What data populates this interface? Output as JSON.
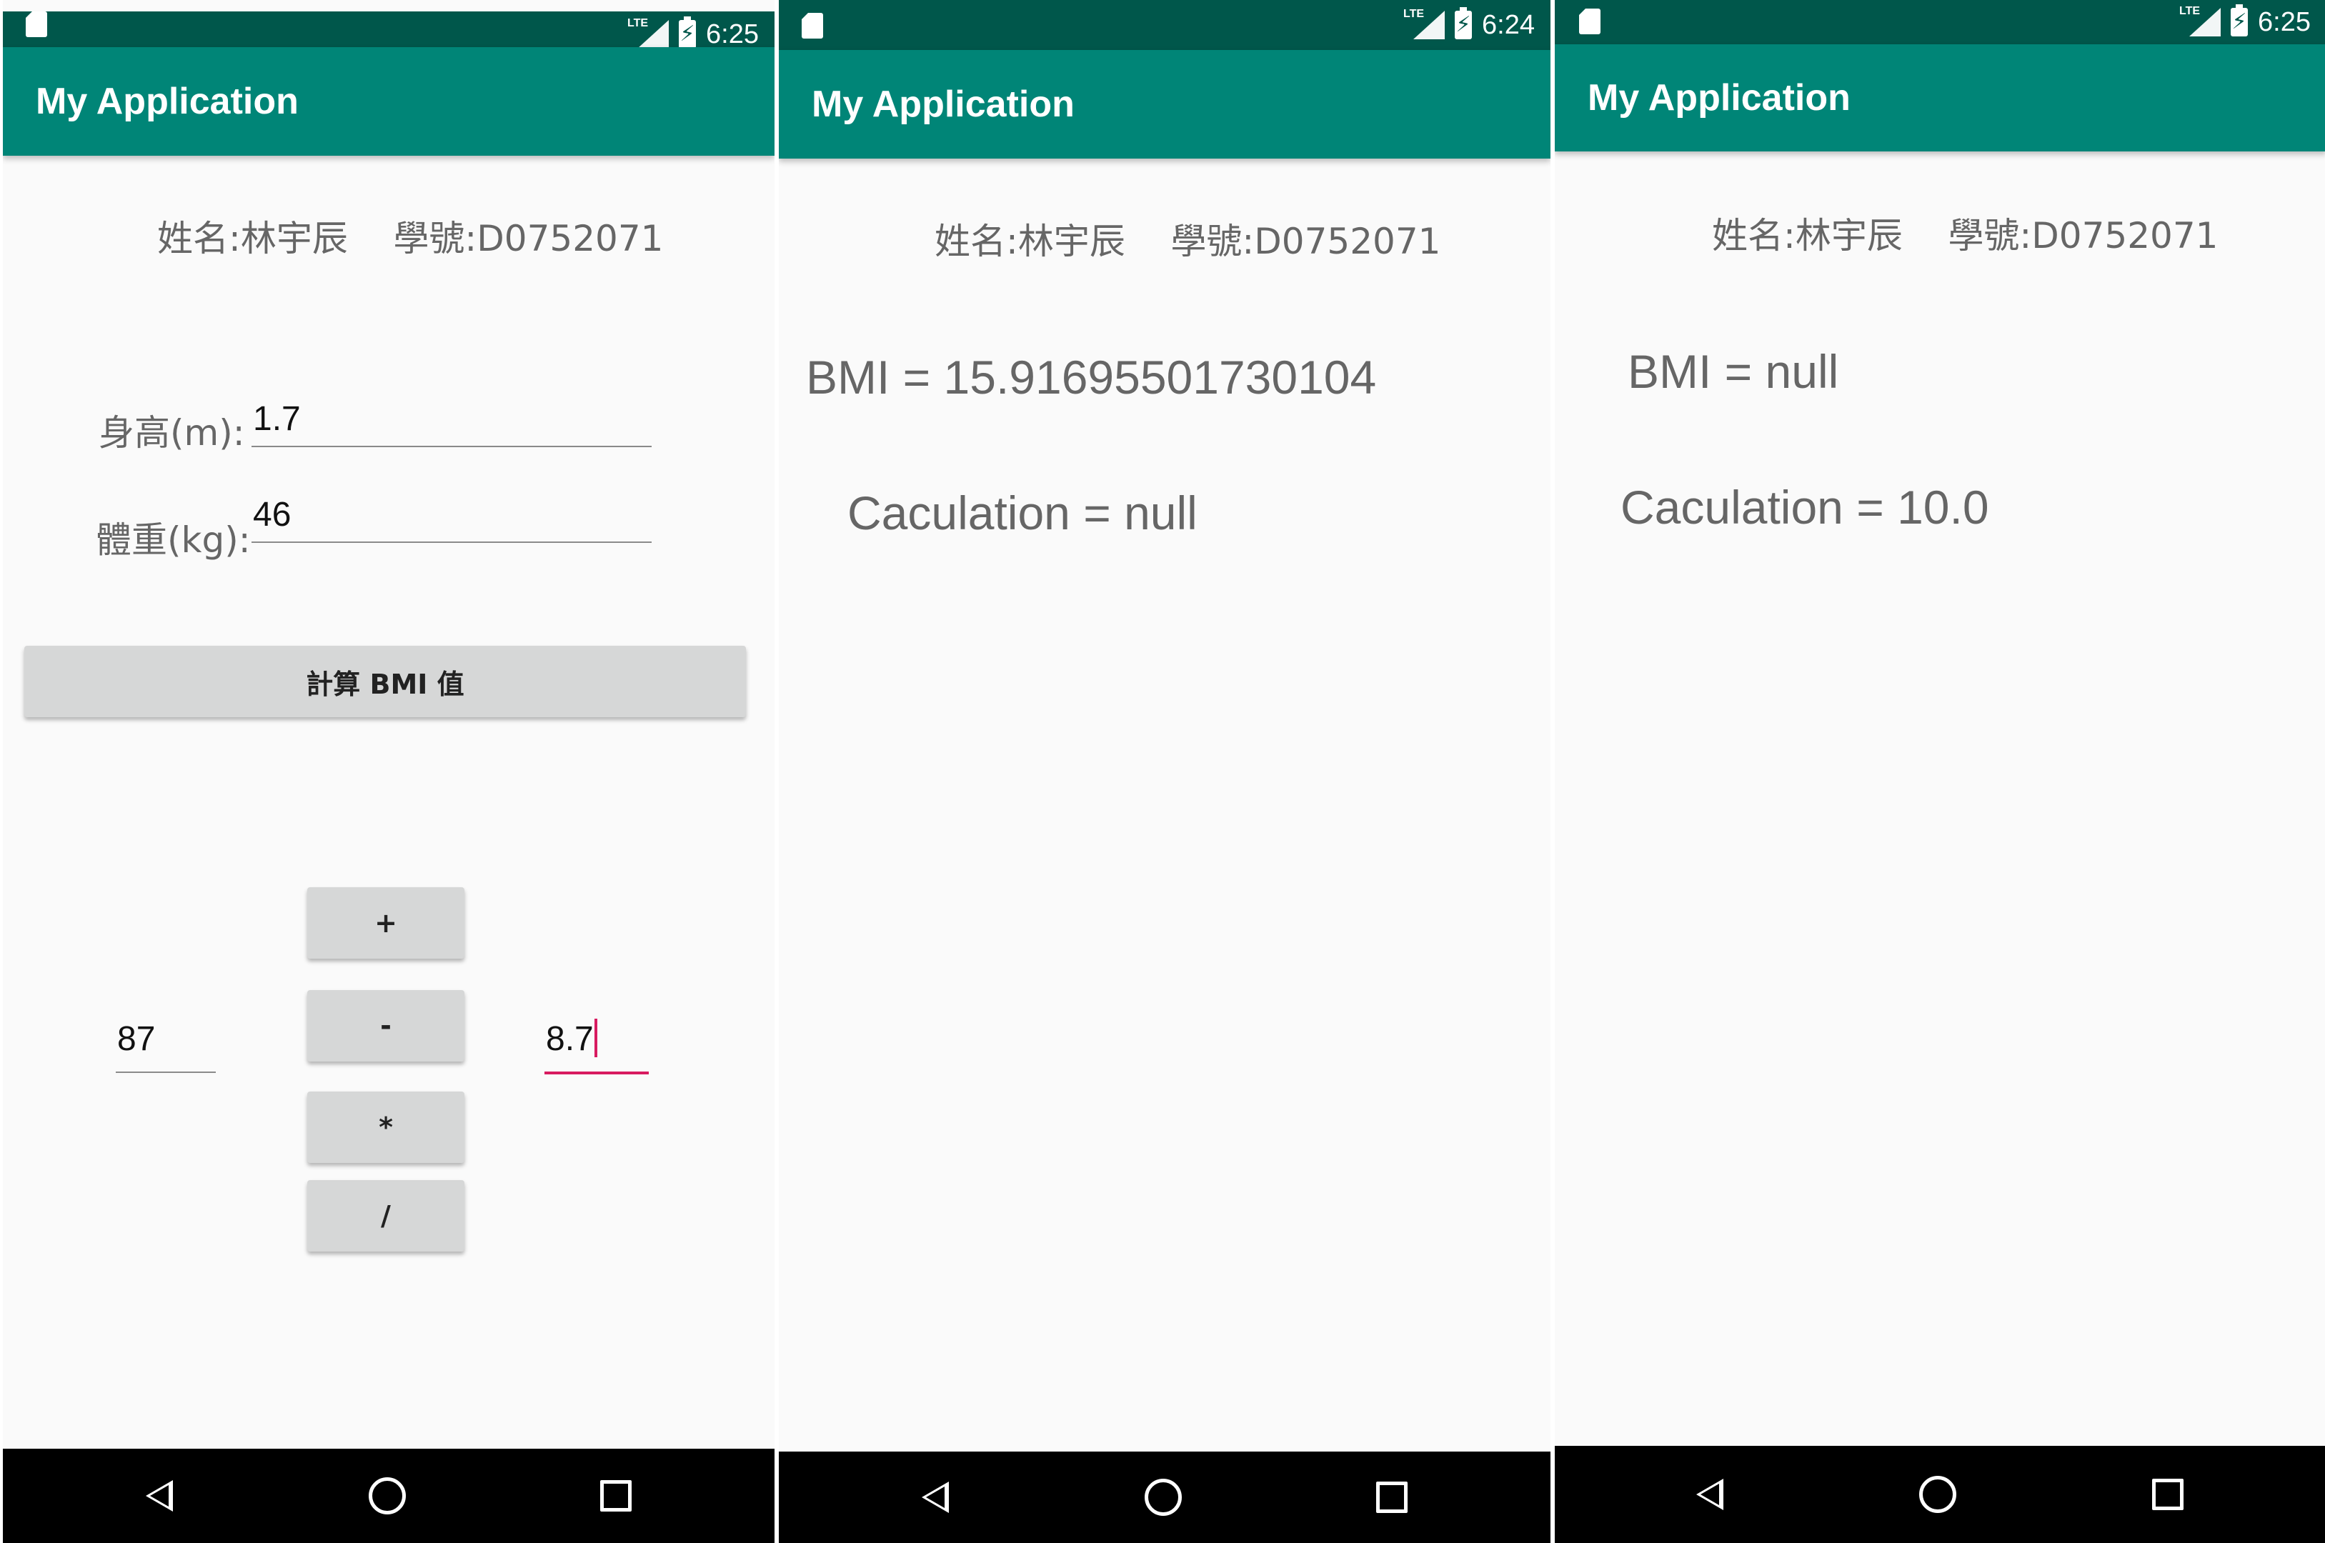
{
  "screens": [
    {
      "status": {
        "time": "6:25",
        "network": "LTE"
      },
      "app_title": "My Application",
      "student": {
        "name": "姓名:林宇辰",
        "id": "學號:D0752071"
      },
      "height_label": "身高(m):",
      "height_value": "1.7",
      "weight_label": "體重(kg):",
      "weight_value": "46",
      "bmi_button": "計算 BMI 值",
      "operand_left": "87",
      "operand_right": "8.7",
      "ops": {
        "add": "+",
        "sub": "-",
        "mul": "*",
        "div": "/"
      }
    },
    {
      "status": {
        "time": "6:24",
        "network": "LTE"
      },
      "app_title": "My Application",
      "student": {
        "name": "姓名:林宇辰",
        "id": "學號:D0752071"
      },
      "bmi_result": "BMI = 15.91695501730104",
      "calc_result": "Caculation = null"
    },
    {
      "status": {
        "time": "6:25",
        "network": "LTE"
      },
      "app_title": "My Application",
      "student": {
        "name": "姓名:林宇辰",
        "id": "學號:D0752071"
      },
      "bmi_result": "BMI = null",
      "calc_result": "Caculation = 10.0"
    }
  ],
  "icons": [
    "sd-card-icon",
    "lte-signal-icon",
    "battery-charging-icon",
    "back-icon",
    "home-icon",
    "recent-apps-icon"
  ],
  "colors": {
    "status_bar": "#00574b",
    "app_bar": "#008577",
    "accent": "#d81b60",
    "background": "#fafafa",
    "nav_bar": "#000000"
  }
}
